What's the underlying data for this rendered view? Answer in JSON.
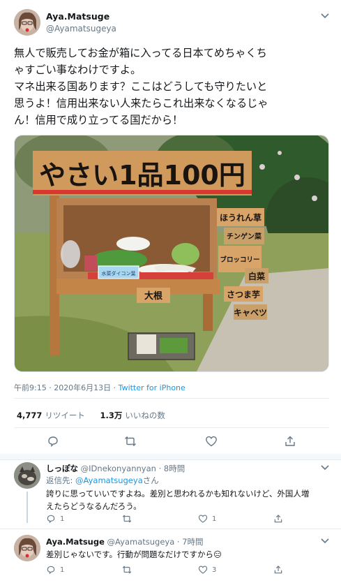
{
  "main_tweet": {
    "author_name": "Aya.Matsuge",
    "author_handle": "@Ayamatsugeya",
    "text_lines": [
      "無人で販売してお金が箱に入ってる日本てめちゃくち",
      "ゃすごい事なわけですよ。",
      "マネ出来る国あります？ここはどうしても守りたいと",
      "思うよ！信用出来ない人来たらこれ出来なくなるじゃ",
      "ん！信用で成り立ってる国だから！"
    ],
    "timestamp": "午前9:15 · 2020年6月13日 · ",
    "via": "Twitter for iPhone",
    "retweets_count": "4,777",
    "retweets_label": "リツイート",
    "likes_count": "1.3万",
    "likes_label": "いいねの数"
  },
  "photo": {
    "sign_main": "やさい1品100円",
    "side_signs": [
      "ほうれん草",
      "チンゲン菜",
      "ブロッコリー",
      "白菜",
      "さつま芋",
      "キャベツ"
    ],
    "front_sign": "大根",
    "price_tag": "水菜ダイコン葉"
  },
  "replies": [
    {
      "name": "しっぽな",
      "handle": "@IDnekonyannyan · 8時間",
      "reply_to_prefix": "返信先: ",
      "reply_to_mention": "@Ayamatsugeya",
      "reply_to_suffix": "さん",
      "text_lines": [
        "誇りに思っていいですよね。差別と思われるかも知れないけど、外国人増",
        "えたらどうなるんだろう。"
      ],
      "reply_count": "1",
      "retweet_count": "",
      "like_count": "1"
    },
    {
      "name": "Aya.Matsuge",
      "handle": "@Ayamatsugeya · 7時間",
      "text_lines": [
        "差別じゃないです。行動が問題なだけですから😑"
      ],
      "reply_count": "1",
      "retweet_count": "",
      "like_count": "3"
    }
  ],
  "colors": {
    "link_blue": "#1b95e0",
    "secondary_text": "#657786",
    "border": "#e6ecf0"
  },
  "icons": [
    "chevron-down-icon",
    "reply-icon",
    "retweet-icon",
    "like-icon",
    "share-icon"
  ]
}
